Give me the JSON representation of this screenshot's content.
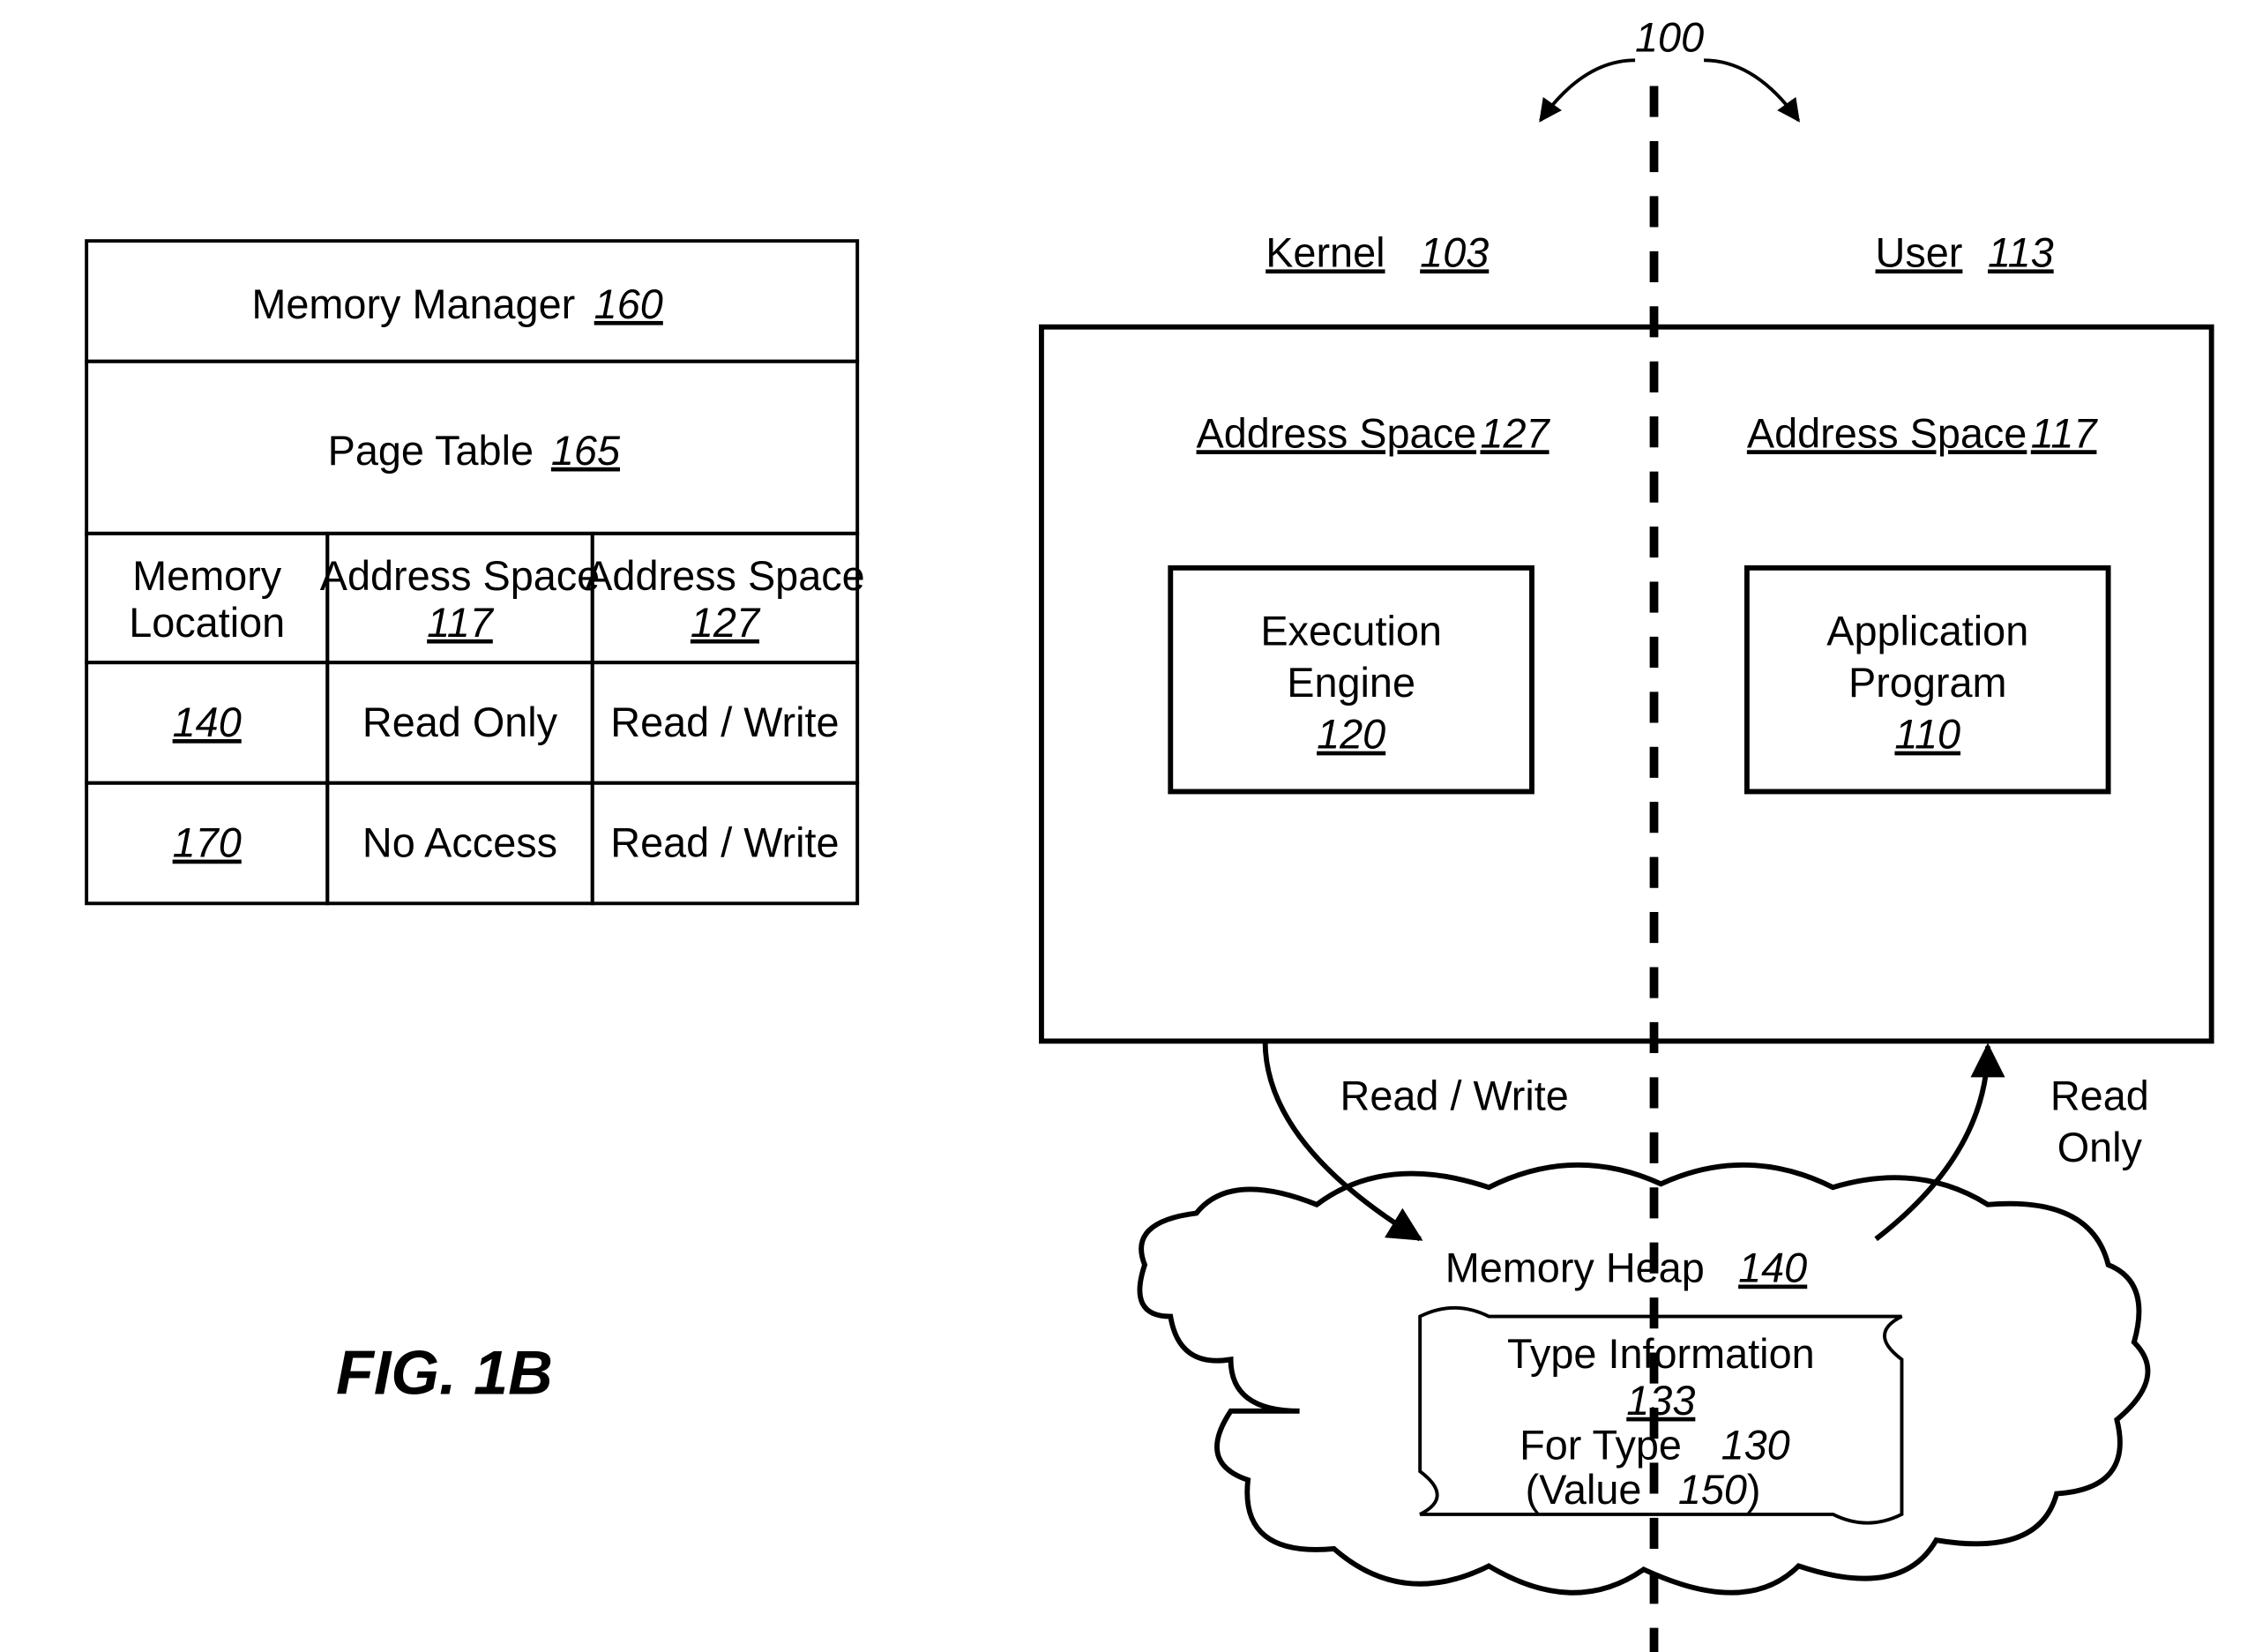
{
  "figureLabel": "FIG.  1B",
  "topRef": "100",
  "kernel": {
    "label": "Kernel",
    "ref": "103"
  },
  "user": {
    "label": "User",
    "ref": "113"
  },
  "addrSpaceLeft": {
    "label": "Address Space",
    "ref": "127"
  },
  "addrSpaceRight": {
    "label": "Address Space",
    "ref": "117"
  },
  "execEngine": {
    "line1": "Execution",
    "line2": "Engine",
    "ref": "120"
  },
  "appProgram": {
    "line1": "Application",
    "line2": "Program",
    "ref": "110"
  },
  "arrowLeftLabel": "Read / Write",
  "arrowRightLabel1": "Read",
  "arrowRightLabel2": "Only",
  "heap": {
    "label": "Memory Heap",
    "ref": "140"
  },
  "typeInfo": {
    "line1": "Type Information",
    "ref": "133",
    "line2a": "For Type",
    "line2ref": "130",
    "line3a": "(Value",
    "line3ref": "150",
    "line3b": ")"
  },
  "memMgr": {
    "label": "Memory Manager",
    "ref": "160"
  },
  "pageTable": {
    "label": "Page Table",
    "ref": "165"
  },
  "tableHeaders": {
    "c1a": "Memory",
    "c1b": "Location",
    "c2a": "Address Space",
    "c2ref": "117",
    "c3a": "Address Space",
    "c3ref": "127"
  },
  "tableRows": [
    {
      "loc": "140",
      "v117": "Read Only",
      "v127": "Read / Write"
    },
    {
      "loc": "170",
      "v117": "No Access",
      "v127": "Read / Write"
    }
  ]
}
